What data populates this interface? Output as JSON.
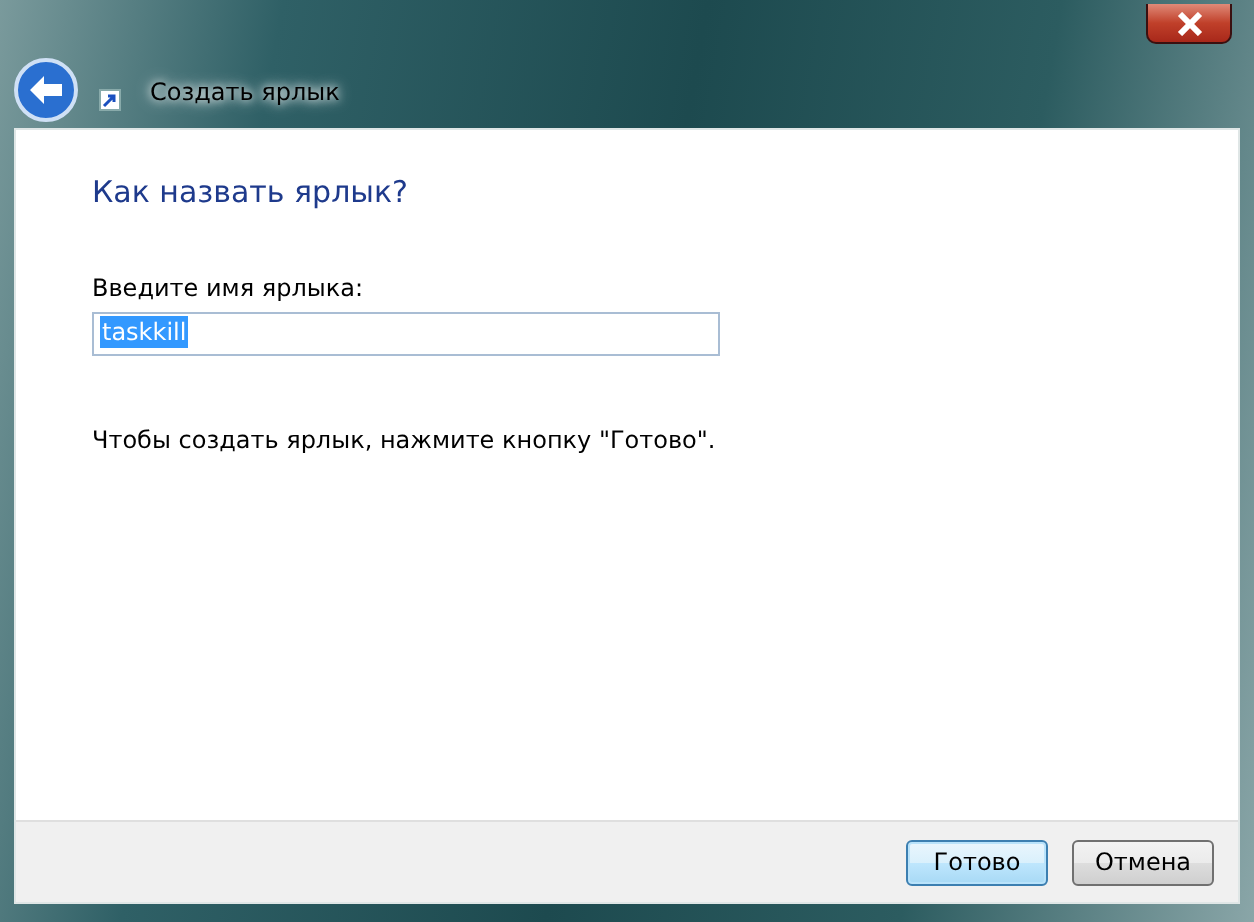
{
  "window": {
    "title": "Создать ярлык"
  },
  "heading": "Как назвать ярлык?",
  "name_field": {
    "label": "Введите имя ярлыка:",
    "value": "taskkill",
    "text_selected": true
  },
  "hint": "Чтобы создать ярлык, нажмите кнопку \"Готово\".",
  "buttons": [
    {
      "label": "Готово",
      "default": true
    },
    {
      "label": "Отмена",
      "default": false
    }
  ]
}
